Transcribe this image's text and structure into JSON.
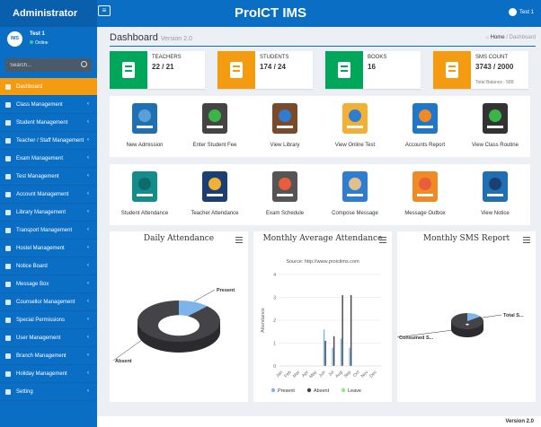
{
  "header": {
    "brand": "Administrator",
    "menu_icon": "≡",
    "app_title": "ProICT IMS",
    "user": "Test 1"
  },
  "sidebar": {
    "user_name": "Test 1",
    "status": "Online",
    "avatar_text": "IMS",
    "search_placeholder": "Search...",
    "items": [
      {
        "label": "Dashboard",
        "active": true
      },
      {
        "label": "Class Management"
      },
      {
        "label": "Student Management"
      },
      {
        "label": "Teacher / Staff Management"
      },
      {
        "label": "Exam Management"
      },
      {
        "label": "Test Management"
      },
      {
        "label": "Account Management"
      },
      {
        "label": "Library Management"
      },
      {
        "label": "Transport Management"
      },
      {
        "label": "Hostel Management"
      },
      {
        "label": "Notice Board"
      },
      {
        "label": "Message Box"
      },
      {
        "label": "Counsellor Management"
      },
      {
        "label": "Special Permissions"
      },
      {
        "label": "User Management"
      },
      {
        "label": "Branch Management"
      },
      {
        "label": "Holiday Management"
      },
      {
        "label": "Setting"
      }
    ]
  },
  "page": {
    "title": "Dashboard",
    "version": "Version 2.0",
    "breadcrumb_home": "Home",
    "breadcrumb_current": "Dashboard"
  },
  "info_boxes": [
    {
      "label": "TEACHERS",
      "value": "22 / 21",
      "color": "#00a65a"
    },
    {
      "label": "STUDENTS",
      "value": "174 / 24",
      "color": "#f39c12"
    },
    {
      "label": "BOOKS",
      "value": "16",
      "color": "#00a65a"
    },
    {
      "label": "SMS COUNT",
      "value": "3743 / 2000",
      "sub": "Total Balance : 589",
      "color": "#f39c12"
    }
  ],
  "tiles_row1": [
    "New Admission",
    "Enter Student Fee",
    "View Library",
    "View Online Test",
    "Accounts Report",
    "View Class Routine"
  ],
  "tiles_row2": [
    "Student Attendance",
    "Teacher Attendance",
    "Exam Schedule",
    "Compose Message",
    "Message Outbox",
    "View Notice"
  ],
  "chart_data": [
    {
      "type": "pie",
      "title": "Daily Attendance",
      "labels": [
        "Present",
        "Absent"
      ],
      "values": [
        12,
        88
      ],
      "colors": [
        "#7cb5ec",
        "#434348"
      ]
    },
    {
      "type": "bar",
      "title": "Monthly Average Attendance",
      "subtitle": "Source: http://www.proictims.com",
      "ylabel": "Attendance",
      "ylim": [
        0,
        4
      ],
      "yticks": [
        0,
        1,
        2,
        3,
        4
      ],
      "categories": [
        "Jan",
        "Feb",
        "Mar",
        "Apr",
        "May",
        "Jun",
        "Jul",
        "Aug",
        "Sep",
        "Oct",
        "Nov",
        "Dec"
      ],
      "series": [
        {
          "name": "Present",
          "color": "#7cb5ec",
          "values": [
            0,
            0,
            0,
            0,
            0,
            1.6,
            0.8,
            1.2,
            0.8,
            0,
            0,
            0
          ]
        },
        {
          "name": "Absent",
          "color": "#434348",
          "values": [
            0,
            0,
            0,
            0,
            0,
            1.1,
            1.3,
            3.1,
            3.1,
            0,
            0,
            0
          ]
        },
        {
          "name": "Leave",
          "color": "#90ed7d",
          "values": [
            0,
            0,
            0,
            0,
            0,
            0,
            0,
            0,
            0,
            0,
            0,
            0
          ]
        }
      ]
    },
    {
      "type": "pie",
      "title": "Monthly SMS Report",
      "labels": [
        "Total S...",
        "Consumed S..."
      ],
      "values": [
        15,
        85
      ],
      "colors": [
        "#7cb5ec",
        "#434348"
      ]
    }
  ],
  "footer": {
    "version": "Version 2.0"
  }
}
